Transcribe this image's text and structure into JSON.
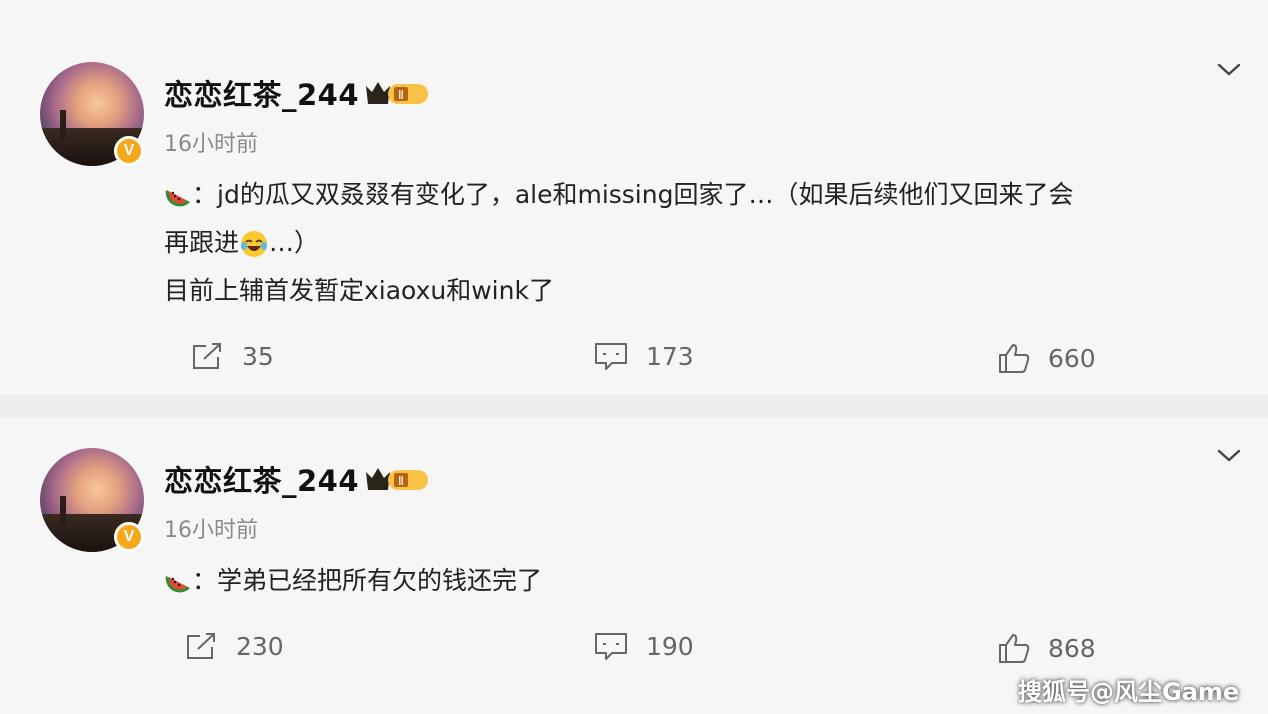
{
  "posts": [
    {
      "username": "恋恋红茶_244",
      "level_badge": "Ⅱ",
      "verified_badge": "V",
      "timestamp": "16小时前",
      "content": {
        "line1_prefix": "：jd的瓜又双叒叕有变化了，ale和missing回家了…（如果后续他们又回来了会",
        "line2_a": "再跟进",
        "line2_b": "…）",
        "line3": "目前上辅首发暂定xiaoxu和wink了"
      },
      "actions": {
        "repost": "35",
        "comment": "173",
        "like": "660"
      }
    },
    {
      "username": "恋恋红茶_244",
      "level_badge": "Ⅱ",
      "verified_badge": "V",
      "timestamp": "16小时前",
      "content": {
        "line1_prefix": "：学弟已经把所有欠的钱还完了"
      },
      "actions": {
        "repost": "230",
        "comment": "190",
        "like": "868"
      }
    }
  ],
  "watermark": "搜狐号@风尘Game",
  "icons": [
    "watermelon-icon",
    "laugh-cry-emoji",
    "repost-icon",
    "comment-icon",
    "like-icon",
    "chevron-down-icon",
    "crown-level-badge"
  ],
  "colors": {
    "text": "#222222",
    "muted": "#8a8a8a",
    "badge": "#f6a81b",
    "card": "#f6f6f6"
  }
}
